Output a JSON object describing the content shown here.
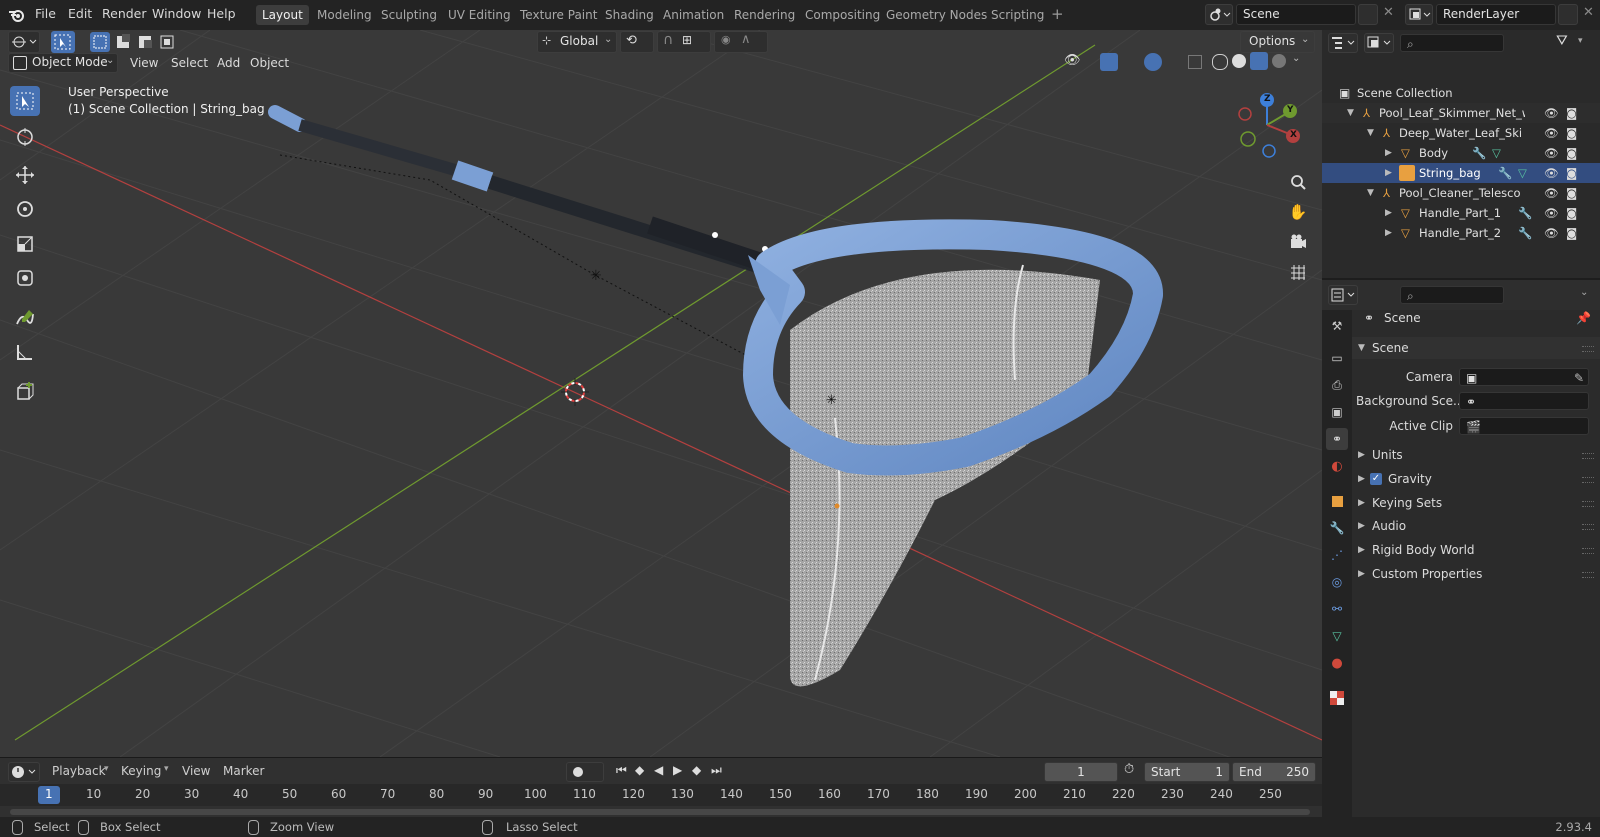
{
  "topbar": {
    "menus": [
      "File",
      "Edit",
      "Render",
      "Window",
      "Help"
    ],
    "workspaces": [
      "Layout",
      "Modeling",
      "Sculpting",
      "UV Editing",
      "Texture Paint",
      "Shading",
      "Animation",
      "Rendering",
      "Compositing",
      "Geometry Nodes",
      "Scripting"
    ],
    "active_workspace": "Layout",
    "scene_name": "Scene",
    "view_layer": "RenderLayer"
  },
  "viewport": {
    "transform_orientation": "Global",
    "options_label": "Options",
    "mode": "Object Mode",
    "header_menus": [
      "View",
      "Select",
      "Add",
      "Object"
    ],
    "overlay_line1": "User Perspective",
    "overlay_line2": "(1) Scene Collection | String_bag",
    "gizmo_axes": [
      "Z",
      "Y",
      "X"
    ]
  },
  "outliner": {
    "root": "Scene Collection",
    "rows": [
      {
        "label": "Pool_Leaf_Skimmer_Net_with_Pole",
        "type": "empty"
      },
      {
        "label": "Deep_Water_Leaf_Skimmer",
        "type": "empty"
      },
      {
        "label": "Body",
        "type": "mesh"
      },
      {
        "label": "String_bag",
        "type": "mesh"
      },
      {
        "label": "Pool_Cleaner_Telescopic_Pole",
        "type": "empty"
      },
      {
        "label": "Handle_Part_1",
        "type": "mesh"
      },
      {
        "label": "Handle_Part_2",
        "type": "mesh"
      }
    ]
  },
  "properties": {
    "context": "Scene",
    "panel_title": "Scene",
    "fields": [
      {
        "label": "Camera",
        "value": ""
      },
      {
        "label": "Background Sce...",
        "value": ""
      },
      {
        "label": "Active Clip",
        "value": ""
      }
    ],
    "sections": [
      "Units",
      "Gravity",
      "Keying Sets",
      "Audio",
      "Rigid Body World",
      "Custom Properties"
    ],
    "gravity_checked": true
  },
  "timeline": {
    "menus": [
      "Playback",
      "Keying",
      "View",
      "Marker"
    ],
    "current_frame": "1",
    "start_label": "Start",
    "start": "1",
    "end_label": "End",
    "end": "250",
    "ruler": [
      "1",
      "10",
      "20",
      "30",
      "40",
      "50",
      "60",
      "70",
      "80",
      "90",
      "100",
      "110",
      "120",
      "130",
      "140",
      "150",
      "160",
      "170",
      "180",
      "190",
      "200",
      "210",
      "220",
      "230",
      "240",
      "250"
    ]
  },
  "statusbar": {
    "items": [
      "Select",
      "Box Select",
      "Zoom View",
      "Lasso Select"
    ],
    "version": "2.93.4"
  },
  "colors": {
    "accent": "#4772b3",
    "net_frame": "#7b9fd4",
    "x_axis": "#b3403f",
    "y_axis": "#6f9a2f",
    "z_axis": "#3d7fd9"
  }
}
